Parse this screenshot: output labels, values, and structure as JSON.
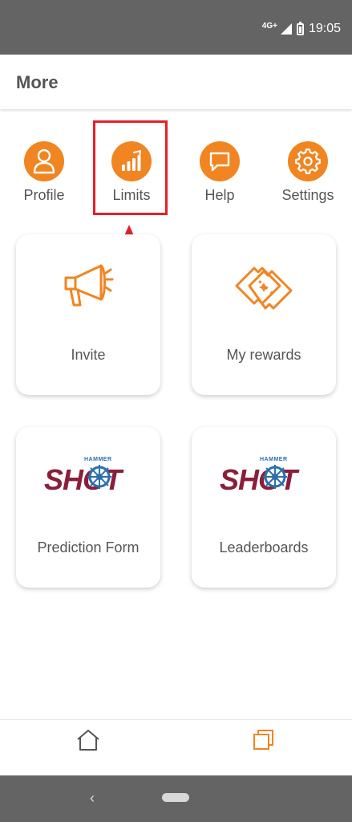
{
  "status": {
    "network": "4G+",
    "time": "19:05"
  },
  "header": {
    "title": "More"
  },
  "menu": [
    {
      "label": "Profile",
      "icon": "profile-icon"
    },
    {
      "label": "Limits",
      "icon": "limits-icon"
    },
    {
      "label": "Help",
      "icon": "help-icon"
    },
    {
      "label": "Settings",
      "icon": "settings-icon"
    }
  ],
  "cards": [
    {
      "label": "Invite",
      "icon": "megaphone-icon"
    },
    {
      "label": "My rewards",
      "icon": "tickets-icon"
    },
    {
      "label": "Prediction Form",
      "logo_word": "SHOT",
      "logo_top": "HAMMER"
    },
    {
      "label": "Leaderboards",
      "logo_word": "SHOT",
      "logo_top": "HAMMER"
    }
  ],
  "colors": {
    "accent": "#f08522",
    "highlight": "#e3202b",
    "logo_maroon": "#8a1f3a",
    "logo_blue": "#2c6fb0"
  },
  "bottom_nav": [
    {
      "icon": "home-icon"
    },
    {
      "icon": "pages-icon"
    }
  ]
}
